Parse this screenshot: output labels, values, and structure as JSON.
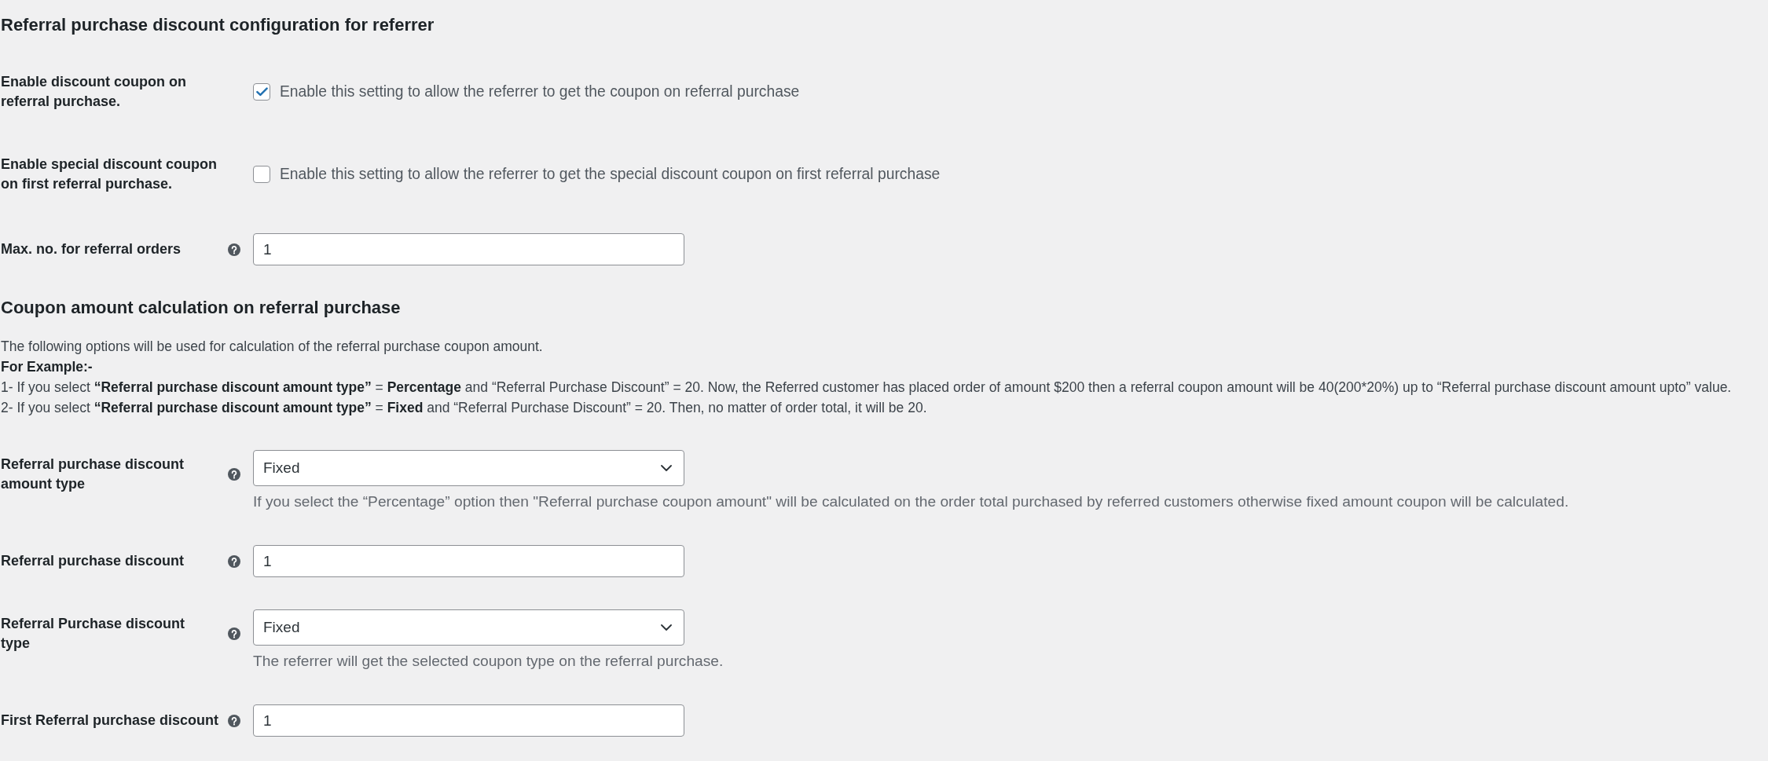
{
  "sections": [
    {
      "title": "Referral purchase discount configuration for referrer",
      "fields": [
        {
          "kind": "checkbox",
          "label": "Enable discount coupon on referral purchase.",
          "help_tip": false,
          "checked": true,
          "text": "Enable this setting to allow the referrer to get the coupon on referral purchase"
        },
        {
          "kind": "checkbox",
          "label": "Enable special discount coupon on first referral purchase.",
          "help_tip": false,
          "checked": false,
          "text": "Enable this setting to allow the referrer to get the special discount coupon on first referral purchase"
        },
        {
          "kind": "input",
          "label": "Max. no. for referral orders",
          "help_tip": true,
          "value": "1"
        }
      ]
    },
    {
      "title": "Coupon amount calculation on referral purchase",
      "description": [
        {
          "kind": "text",
          "text": "The following options will be used for calculation of the referral purchase coupon amount."
        },
        {
          "kind": "heading",
          "text": "For Example:-"
        },
        {
          "kind": "text",
          "text": "1- If you select **“Referral purchase discount amount type”** = **Percentage** and “Referral Purchase Discount” = 20. Now, the Referred customer has placed order of amount $200 then a referral coupon amount will be 40(200*20%) up to “Referral purchase discount amount upto” value."
        },
        {
          "kind": "text",
          "text": "2- If you select **“Referral purchase discount amount type”** = **Fixed** and “Referral Purchase Discount” = 20. Then, no matter of order total, it will be 20."
        }
      ],
      "fields": [
        {
          "kind": "select",
          "label": "Referral purchase discount amount type",
          "help_tip": true,
          "value": "Fixed",
          "hint": "If you select the “Percentage” option then \"Referral purchase coupon amount\" will be calculated on the order total purchased by referred customers otherwise fixed amount coupon will be calculated."
        },
        {
          "kind": "input",
          "label": "Referral purchase discount",
          "help_tip": true,
          "value": "1"
        },
        {
          "kind": "select",
          "label": "Referral Purchase discount type",
          "help_tip": true,
          "value": "Fixed",
          "hint": "The referrer will get the selected coupon type on the referral purchase."
        },
        {
          "kind": "input",
          "label": "First Referral purchase discount",
          "help_tip": true,
          "value": "1"
        }
      ]
    }
  ]
}
